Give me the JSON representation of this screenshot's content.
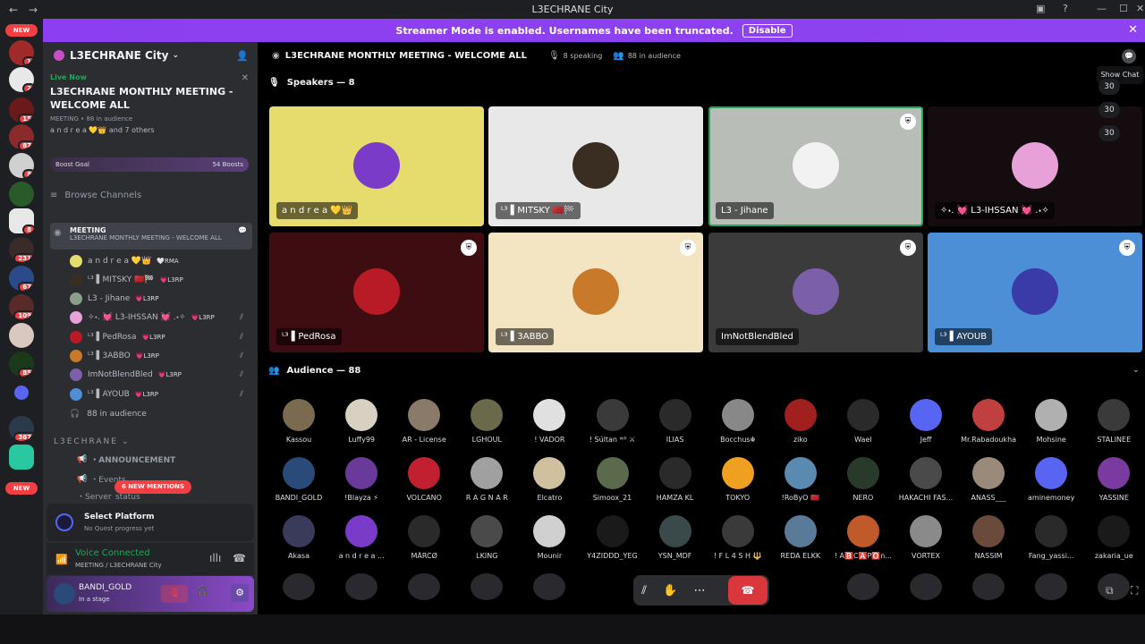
{
  "window": {
    "title": "L3ECHRANE City"
  },
  "banner": {
    "text": "Streamer Mode is enabled. Usernames have been truncated.",
    "button": "Disable"
  },
  "guilds": {
    "new_top": "NEW",
    "new_bottom": "NEW",
    "badges": [
      "1",
      "2",
      "15",
      "87",
      "8",
      "8",
      "8",
      "231",
      "67",
      "109",
      "85",
      "367"
    ]
  },
  "server": {
    "name": "L3ECHRANE City",
    "live": {
      "label": "Live Now",
      "title": "L3ECHRANE MONTHLY MEETING - WELCOME ALL",
      "meta": "MEETING • 88 in audience",
      "people": "a n d r e a 💛👑 and 7 others"
    },
    "boost": {
      "label": "Boost Goal",
      "value": "54 Boosts"
    },
    "browse": "Browse Channels",
    "stage": {
      "name": "MEETING",
      "topic": "L3ECHRANE MONTHLY MEETING - WELCOME ALL"
    },
    "speakers": [
      {
        "name": "a n d r e a 💛👑",
        "tag": "🤍RMA"
      },
      {
        "name": "ᴸ³ ▌MITSKY 🇲🇦🏁",
        "tag": "💗L3RP"
      },
      {
        "name": "L3 - Jihane",
        "tag": "💗L3RP"
      },
      {
        "name": "✧˖. 💓 L3-IHSSAN 💓 .˖✧",
        "tag": "💗L3RP"
      },
      {
        "name": "ᴸ³ ▌PedRosa",
        "tag": "💗L3RP"
      },
      {
        "name": "ᴸ³ ▌3ABBO",
        "tag": "💗L3RP"
      },
      {
        "name": "ImNotBlendBled",
        "tag": "💗L3RP"
      },
      {
        "name": "ᴸ³ ▌AYOUB",
        "tag": "💗L3RP"
      }
    ],
    "audience_count": "88 in audience",
    "category": "L3ECHRANE",
    "channels": [
      "・ANNOUNCEMENT",
      "・Events",
      "・Server_status"
    ],
    "new_mentions": "6 NEW MENTIONS"
  },
  "quest": {
    "title": "Select Platform",
    "sub": "No Quest progress yet"
  },
  "voice": {
    "status": "Voice Connected",
    "channel": "MEETING / L3ECHRANE City"
  },
  "user": {
    "name": "BANDI_GOLD",
    "status": "In a stage"
  },
  "stagebar": {
    "title": "L3ECHRANE MONTHLY MEETING - WELCOME ALL",
    "speaking": "8 speaking",
    "audience": "88 in audience"
  },
  "tooltip": "Show Chat",
  "counts": [
    "30",
    "30",
    "30"
  ],
  "speakers_header": "Speakers — 8",
  "audience_header": "Audience — 88",
  "tiles": [
    {
      "name": "a n d r e a 💛👑",
      "bg": "#e6dc6e",
      "av": "#7a3cc8",
      "shield": false
    },
    {
      "name": "ᴸ³ ▌MITSKY 🇲🇦🏁",
      "bg": "#e8e8e8",
      "av": "#3a2e22",
      "shield": false
    },
    {
      "name": "L3 - Jihane",
      "bg": "#b9bdb7",
      "av": "#f2f2f2",
      "shield": true
    },
    {
      "name": "✧˖. 💓 L3-IHSSAN 💓 .˖✧",
      "bg": "#140c0e",
      "av": "#e8a0d8",
      "shield": false
    },
    {
      "name": "ᴸ³ ▌PedRosa",
      "bg": "#3e0d12",
      "av": "#b81a26",
      "shield": true
    },
    {
      "name": "ᴸ³ ▌3ABBO",
      "bg": "#f3e5c1",
      "av": "#c87a2a",
      "shield": true
    },
    {
      "name": "ImNotBlendBled",
      "bg": "#3b3b3b",
      "av": "#7b5fa8",
      "shield": true
    },
    {
      "name": "ᴸ³ ▌AYOUB",
      "bg": "#4d8fd6",
      "av": "#3a3aa8",
      "shield": true
    }
  ],
  "audience": [
    [
      "Kassou",
      "#7a6a50"
    ],
    [
      "Luffy99",
      "#d8d0c0"
    ],
    [
      "AR - License",
      "#8a7a6a"
    ],
    [
      "LGHOUL",
      "#6a6a4a"
    ],
    [
      "! VADOR",
      "#e0e0e0"
    ],
    [
      "! Súltan ᵂᴾ ⚔",
      "#3a3a3a"
    ],
    [
      "ILIAS",
      "#2a2a2a"
    ],
    [
      "Bocchus☬",
      "#888888"
    ],
    [
      "ziko",
      "#a02020"
    ],
    [
      "Wael",
      "#2a2a2a"
    ],
    [
      "Jeff",
      "#5865f2"
    ],
    [
      "Mr.Rabadoukha",
      "#c04040"
    ],
    [
      "Mohsine",
      "#b0b0b0"
    ],
    [
      "STALINEE",
      "#3a3a3a"
    ],
    [
      "BANDI_GOLD",
      "#2a4a7a"
    ],
    [
      "!Blayza ⚡",
      "#6a3a9a"
    ],
    [
      "VOLCANO",
      "#c02030"
    ],
    [
      "R A G N A R",
      "#a0a0a0"
    ],
    [
      "Elcatro",
      "#d0c0a0"
    ],
    [
      "Simoox_21",
      "#5a6a4a"
    ],
    [
      "HAMZA KL",
      "#2a2a2a"
    ],
    [
      "TOKYO",
      "#f0a020"
    ],
    [
      "!RoByO 🇲🇦",
      "#5a8ab0"
    ],
    [
      "NERO",
      "#2a3a2a"
    ],
    [
      "HAKACHI FAS...",
      "#4a4a4a"
    ],
    [
      "ANASS___",
      "#9a8a7a"
    ],
    [
      "aminemoney",
      "#5865f2"
    ],
    [
      "YASSINE",
      "#7a3aa0"
    ],
    [
      "Akasa",
      "#3a3a5a"
    ],
    [
      "a n d r e a ...",
      "#7a3cc8"
    ],
    [
      "MÄRCØ",
      "#2a2a2a"
    ],
    [
      "LKING",
      "#4a4a4a"
    ],
    [
      "Mounir",
      "#d0d0d0"
    ],
    [
      "Y4ZIDDD_YEG",
      "#1a1a1a"
    ],
    [
      "YSN_MDF",
      "#3a4a4a"
    ],
    [
      "! F L 4 S H 🔱",
      "#3a3a3a"
    ],
    [
      "REDA ELKK",
      "#5a7a9a"
    ],
    [
      "! A🅱️C🅰️P🅾️n...",
      "#c05a2a"
    ],
    [
      "VORTEX",
      "#8a8a8a"
    ],
    [
      "NASSIM",
      "#6a4a3a"
    ],
    [
      "Fang_yassi...",
      "#2a2a2a"
    ],
    [
      "zakaria_ue",
      "#1a1a1a"
    ]
  ]
}
